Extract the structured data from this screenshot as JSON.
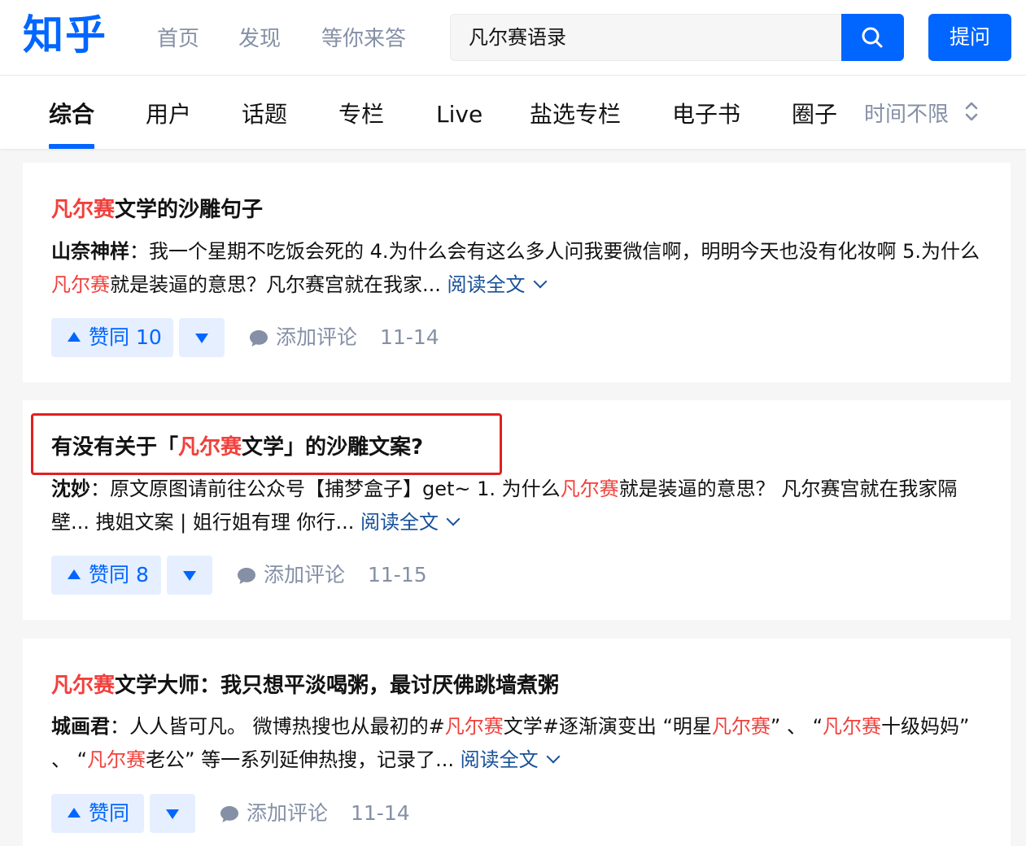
{
  "header": {
    "logo": "知乎",
    "nav": [
      "首页",
      "发现",
      "等你来答"
    ],
    "search_value": "凡尔赛语录",
    "ask_button": "提问"
  },
  "tabs": {
    "items": [
      "综合",
      "用户",
      "话题",
      "专栏",
      "Live",
      "盐选专栏",
      "电子书",
      "圈子"
    ],
    "active": "综合",
    "time_filter": "时间不限"
  },
  "results": [
    {
      "title_hl": "凡尔赛",
      "title_rest": "文学的沙雕句子",
      "author": "山奈神样",
      "excerpt_a": "：我一个星期不吃饭会死的 4.为什么会有这么多人问我要微信啊，明明今天也没有化妆啊 5.为什么",
      "excerpt_hl": "凡尔赛",
      "excerpt_b": "就是装逼的意思？凡尔赛宫就在我家... ",
      "read_more": "阅读全文",
      "vote_label": "赞同 10",
      "comment": "添加评论",
      "date": "11-14"
    },
    {
      "title_pre": "有没有关于「",
      "title_hl": "凡尔赛",
      "title_rest": "文学」的沙雕文案?",
      "author": "沈妙",
      "excerpt_a": "：原文原图请前往公众号【捕梦盒子】get~ 1. 为什么",
      "excerpt_hl": "凡尔赛",
      "excerpt_b": "就是装逼的意思？ 凡尔赛宫就在我家隔壁... 拽姐文案 | 姐行姐有理 你行... ",
      "read_more": "阅读全文",
      "vote_label": "赞同 8",
      "comment": "添加评论",
      "date": "11-15"
    },
    {
      "title_hl": "凡尔赛",
      "title_rest": "文学大师：我只想平淡喝粥，最讨厌佛跳墙煮粥",
      "author": "城画君",
      "excerpt_a": "：人人皆可凡。 微博热搜也从最初的#",
      "excerpt_hl1": "凡尔赛",
      "excerpt_b": "文学#逐渐演变出 “明星",
      "excerpt_hl2": "凡尔赛",
      "excerpt_c": "” 、 “",
      "excerpt_hl3": "凡尔赛",
      "excerpt_d": "十级妈妈” 、 “",
      "excerpt_hl4": "凡尔赛",
      "excerpt_e": "老公” 等一系列延伸热搜，记录了... ",
      "read_more": "阅读全文",
      "vote_label": "赞同",
      "comment": "添加评论",
      "date": "11-14"
    }
  ],
  "colors": {
    "brand": "#0066ff",
    "highlight": "#f1403c",
    "link": "#175199",
    "muted": "#8590a6",
    "annotation": "#e02020"
  },
  "icons": [
    "search-icon",
    "sort-toggle-icon",
    "vote-up-icon",
    "vote-down-icon",
    "comment-icon",
    "chevron-down-icon"
  ]
}
